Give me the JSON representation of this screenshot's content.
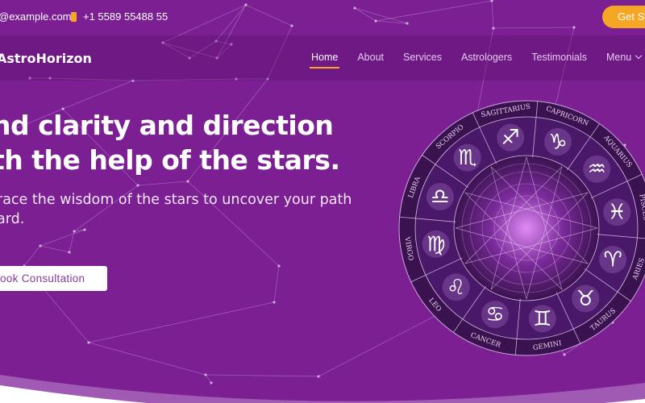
{
  "topbar": {
    "email": "@example.com",
    "phone": "+1 5589 55488 55",
    "cta_label": "Get Started"
  },
  "navbar": {
    "logo": "AstroHorizon",
    "items": [
      {
        "label": "Home",
        "active": true
      },
      {
        "label": "About"
      },
      {
        "label": "Services"
      },
      {
        "label": "Astrologers"
      },
      {
        "label": "Testimonials"
      },
      {
        "label": "Menu",
        "dropdown": true
      }
    ]
  },
  "hero": {
    "title_line1": "nd clarity and direction",
    "title_line2": "th the help of the stars.",
    "subtitle": "race the wisdom of the stars to uncover your path ard.",
    "button_label": "ook Consultation"
  },
  "wheel": {
    "signs": [
      "SAGITTARIUS",
      "CAPRICORN",
      "AQUARIUS",
      "PISCES",
      "ARIES",
      "TAURUS",
      "GEMINI",
      "CANCER",
      "LEO",
      "VIRGO",
      "LIBRA",
      "SCORPIO"
    ],
    "glyphs": [
      "♐",
      "♑",
      "♒",
      "♓",
      "♈",
      "♉",
      "♊",
      "♋",
      "♌",
      "♍",
      "♎",
      "♏"
    ]
  },
  "colors": {
    "background": "#7b1f93",
    "accent": "#f5a623",
    "wheel": "#3b1250"
  }
}
